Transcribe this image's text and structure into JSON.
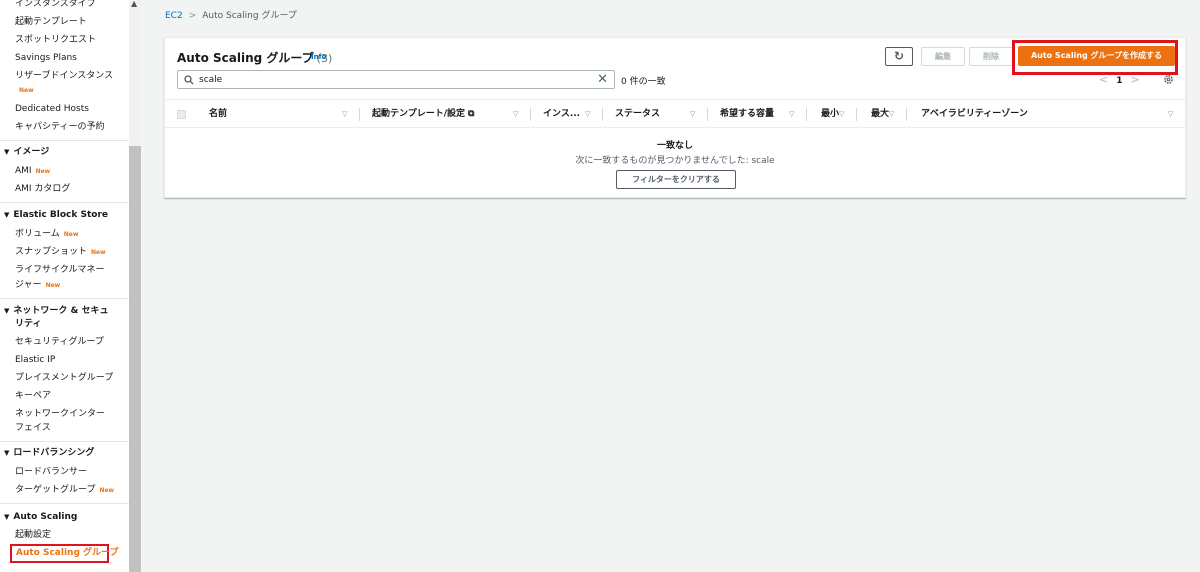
{
  "sidebar": {
    "items": [
      {
        "label": "インスタンスタイプ"
      },
      {
        "label": "起動テンプレート"
      },
      {
        "label": "スポットリクエスト"
      },
      {
        "label": "Savings Plans"
      },
      {
        "label": "リザーブドインスタンス",
        "badge": "New"
      },
      {
        "label": "Dedicated Hosts"
      },
      {
        "label": "キャパシティーの予約"
      }
    ],
    "sections": [
      {
        "title": "イメージ",
        "items": [
          {
            "label": "AMI",
            "badge": "New"
          },
          {
            "label": "AMI カタログ"
          }
        ]
      },
      {
        "title": "Elastic Block Store",
        "items": [
          {
            "label": "ボリューム",
            "badge": "New"
          },
          {
            "label": "スナップショット",
            "badge": "New"
          },
          {
            "label": "ライフサイクルマネー",
            "label2": "ジャー",
            "badge": "New"
          }
        ]
      },
      {
        "title": "ネットワーク & セキュ",
        "title2": "リティ",
        "items": [
          {
            "label": "セキュリティグループ"
          },
          {
            "label": "Elastic IP"
          },
          {
            "label": "プレイスメントグループ"
          },
          {
            "label": "キーペア"
          },
          {
            "label": "ネットワークインター",
            "label2": "フェイス"
          }
        ]
      },
      {
        "title": "ロードバランシング",
        "items": [
          {
            "label": "ロードバランサー"
          },
          {
            "label": "ターゲットグループ",
            "badge": "New"
          }
        ]
      },
      {
        "title": "Auto Scaling",
        "items": [
          {
            "label": "起動設定"
          },
          {
            "label": "Auto Scaling グループ",
            "active": true
          }
        ]
      }
    ]
  },
  "breadcrumb": {
    "root": "EC2",
    "separator": ">",
    "current": "Auto Scaling グループ"
  },
  "panel": {
    "title": "Auto Scaling グループ",
    "count": "(3)",
    "info": "Info",
    "buttons": {
      "edit": "編集",
      "delete": "削除",
      "create": "Auto Scaling グループを作成する"
    },
    "search": {
      "value": "scale",
      "clear_symbol": "✕"
    },
    "match_count": "0 件の一致",
    "pager": {
      "prev": "<",
      "page": "1",
      "next": ">"
    },
    "columns": [
      "名前",
      "起動テンプレート/設定",
      "インス...",
      "ステータス",
      "希望する容量",
      "最小",
      "最大",
      "アベイラビリティーゾーン"
    ],
    "empty": {
      "title": "一致なし",
      "description": "次に一致するものが見つかりませんでした: scale",
      "clear_button": "フィルターをクリアする"
    }
  },
  "colors": {
    "accent": "#ec7211",
    "link": "#0073bb",
    "highlight": "#e0131a"
  }
}
